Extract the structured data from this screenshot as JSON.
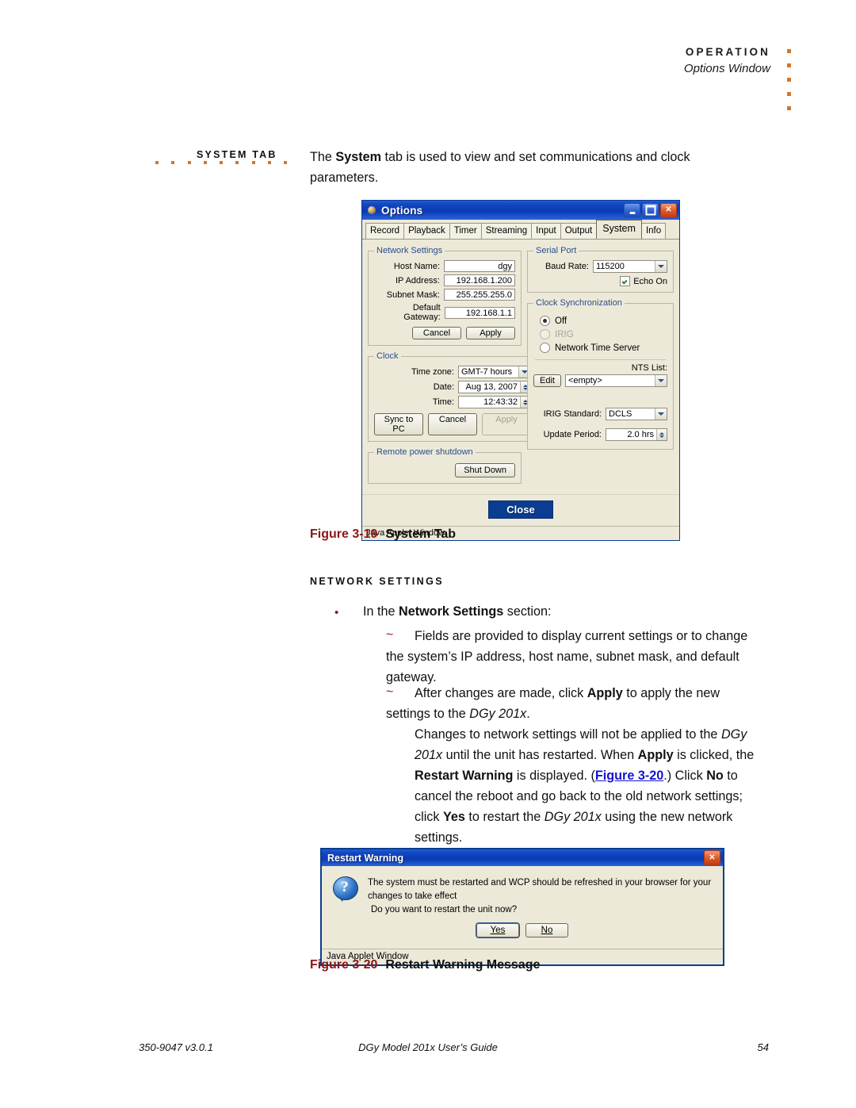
{
  "header": {
    "title": "OPERATION",
    "subtitle": "Options Window"
  },
  "margin_label": "SYSTEM TAB",
  "intro": {
    "before": "The ",
    "bold": "System",
    "after": " tab is used to view and set communications and clock parameters."
  },
  "options_window": {
    "title": "Options",
    "icon": "coffee-cup-icon",
    "window_buttons": [
      "minimize",
      "maximize",
      "close"
    ],
    "tabs": [
      {
        "label": "Record",
        "active": false
      },
      {
        "label": "Playback",
        "active": false
      },
      {
        "label": "Timer",
        "active": false
      },
      {
        "label": "Streaming",
        "active": false
      },
      {
        "label": "Input",
        "active": false
      },
      {
        "label": "Output",
        "active": false
      },
      {
        "label": "System",
        "active": true
      },
      {
        "label": "Info",
        "active": false
      }
    ],
    "network_settings": {
      "legend": "Network Settings",
      "fields": [
        {
          "label": "Host Name:",
          "value": "dgy"
        },
        {
          "label": "IP Address:",
          "value": "192.168.1.200"
        },
        {
          "label": "Subnet Mask:",
          "value": "255.255.255.0"
        },
        {
          "label": "Default Gateway:",
          "value": "192.168.1.1"
        }
      ],
      "cancel": "Cancel",
      "apply": "Apply"
    },
    "clock": {
      "legend": "Clock",
      "timezone_label": "Time zone:",
      "timezone_value": "GMT-7 hours",
      "date_label": "Date:",
      "date_value": "Aug 13, 2007",
      "time_label": "Time:",
      "time_value": "12:43:32",
      "sync": "Sync to PC",
      "cancel": "Cancel",
      "apply": "Apply"
    },
    "remote_power": {
      "legend": "Remote power shutdown",
      "button": "Shut Down"
    },
    "serial_port": {
      "legend": "Serial Port",
      "baud_label": "Baud Rate:",
      "baud_value": "115200",
      "echo_label": "Echo On",
      "echo_checked": true
    },
    "clock_sync": {
      "legend": "Clock Synchronization",
      "options": [
        {
          "label": "Off",
          "selected": true,
          "disabled": false
        },
        {
          "label": "IRIG",
          "selected": false,
          "disabled": true
        },
        {
          "label": "Network Time Server",
          "selected": false,
          "disabled": false
        }
      ],
      "nts_list_label": "NTS List:",
      "edit_button": "Edit",
      "nts_value": "<empty>"
    },
    "irig": {
      "standard_label": "IRIG Standard:",
      "standard_value": "DCLS",
      "update_label": "Update Period:",
      "update_value": "2.0 hrs"
    },
    "close_button": "Close",
    "status_bar": "Java Applet Window"
  },
  "figure_19": {
    "number": "Figure 3-19",
    "name": "System Tab"
  },
  "section_heading": "NETWORK SETTINGS",
  "bullet1": {
    "before": "In the ",
    "bold": "Network Settings",
    "after": " section:"
  },
  "sub1": "Fields are provided to display current settings or to change the system’s IP address, host name, subnet mask, and default gateway.",
  "sub2": {
    "p1": "After changes are made, click ",
    "b1": "Apply",
    "p2": " to apply the new settings to the ",
    "i1": "DGy 201x",
    "p3": "."
  },
  "para": {
    "p1": "Changes to network settings will not be applied to the ",
    "i1": "DGy 201x",
    "p2": " until the unit has restarted. When ",
    "b1": "Apply",
    "p3": " is clicked, the ",
    "b2": "Restart Warning",
    "p4": " is displayed. (",
    "link": "Figure 3-20",
    "p5": ".) Click ",
    "b3": "No",
    "p6": " to cancel the reboot and go back to the old network settings; click ",
    "b4": "Yes",
    "p7": " to restart the ",
    "i2": "DGy 201x",
    "p8": " using the new network settings."
  },
  "restart_warning": {
    "title": "Restart Warning",
    "icon": "question-icon",
    "line1": "The system must be restarted and WCP should be refreshed in your browser for your changes to take effect",
    "line2": "Do you want to restart the unit now?",
    "yes": "Yes",
    "no": "No",
    "status_bar": "Java Applet Window"
  },
  "figure_20": {
    "number": "Figure 3-20",
    "name": "Restart Warning Message"
  },
  "footer": {
    "left": "350-9047 v3.0.1",
    "center": "DGy Model 201x User’s Guide",
    "right": "54"
  },
  "colors": {
    "accent_orange": "#d4762a",
    "figure_red": "#8c1616",
    "link_blue": "#1414d2",
    "title_blue": "#0a3d91"
  }
}
